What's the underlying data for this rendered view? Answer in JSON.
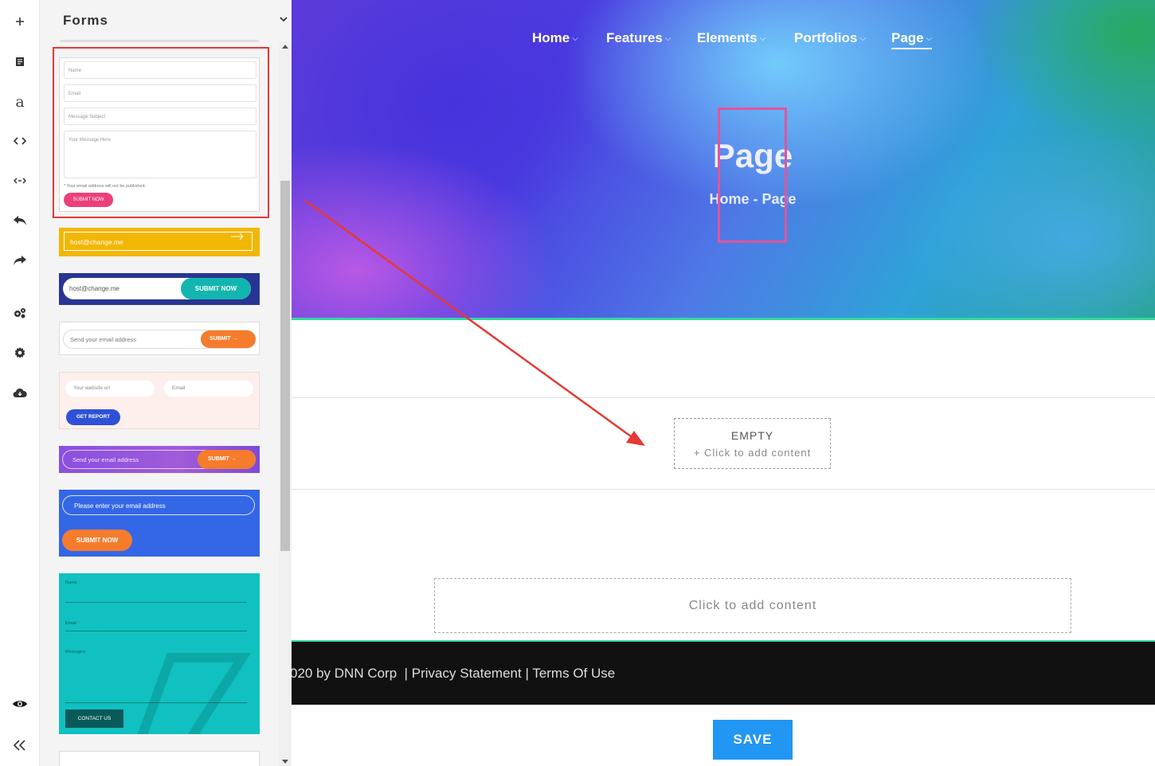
{
  "sidebar": {
    "title": "Forms",
    "rail_icons": [
      "add-icon",
      "page-icon",
      "text-icon",
      "code-icon",
      "embed-icon",
      "undo-icon",
      "redo-icon",
      "gears-icon",
      "settings-icon",
      "cloud-download-icon",
      "preview-eye-icon",
      "collapse-icon"
    ],
    "text_icon_glyph": "a"
  },
  "templates": {
    "contact": {
      "name_ph": "Name",
      "email_ph": "Email",
      "subject_ph": "Message Subject",
      "message_ph": "Your Message Here",
      "note": "* Your email address will not be published.",
      "button": "SUBMIT NOW"
    },
    "yellow": {
      "email": "host@change.me"
    },
    "navy": {
      "email": "host@change.me",
      "button": "SUBMIT NOW"
    },
    "white": {
      "placeholder": "Send your email address",
      "button": "SUBMIT"
    },
    "report": {
      "url_ph": "Your website url",
      "email_ph": "Email",
      "button": "GET REPORT"
    },
    "purple": {
      "placeholder": "Send your email address",
      "button": "SUBMIT"
    },
    "blue": {
      "placeholder": "Please enter your email address",
      "button": "SUBMIT NOW"
    },
    "teal": {
      "name_label": "Name",
      "email_label": "Email",
      "messages_label": "Messages",
      "required_mark": "*",
      "button": "CONTACT US"
    }
  },
  "nav": [
    {
      "label": "Home",
      "active": false
    },
    {
      "label": "Features",
      "active": false
    },
    {
      "label": "Elements",
      "active": false
    },
    {
      "label": "Portfolios",
      "active": false
    },
    {
      "label": "Page",
      "active": true
    }
  ],
  "hero": {
    "title": "Page",
    "breadcrumb": "Home - Page"
  },
  "content": {
    "empty_title": "EMPTY",
    "empty_sub": "+ Click to add content",
    "add_content": "Click to add content"
  },
  "footer": {
    "copyright": "020 by DNN Corp",
    "privacy": "Privacy Statement",
    "terms": "Terms Of Use",
    "separator": "|"
  },
  "save_label": "SAVE",
  "colors": {
    "accent_blue": "#2196f3",
    "selection_red": "#e53935",
    "selection_pink": "#e0559a",
    "annotation_arrow": "#e53935"
  }
}
